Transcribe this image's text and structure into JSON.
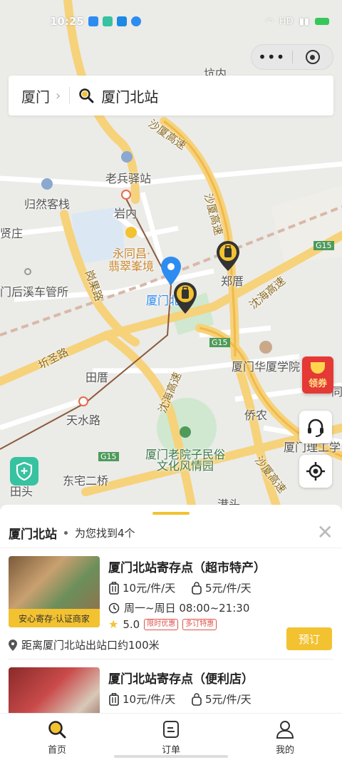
{
  "status_bar": {
    "time": "10:25",
    "network": "HD"
  },
  "colors": {
    "accent": "#f2c230",
    "pin_blue": "#2d8cf0",
    "tag_red": "#e0534c",
    "green": "#37c2a0",
    "coupon_red": "#e53935"
  },
  "search": {
    "city": "厦门",
    "query": "厦门北站"
  },
  "map": {
    "labels": {
      "kengnei": "坑内",
      "shaxia_top": "沙厦高速",
      "shaxia_mid": "沙厦高速",
      "laobing": "老兵驿站",
      "guiran": "归然客栈",
      "yannei": "岩内",
      "xianzhuang": "贤庄",
      "yongtongchang_1": "永同昌·",
      "yongtongchang_2": "翡翠峯境",
      "zhengcuo": "郑厝",
      "menhou": "门后溪车管所",
      "xiamen_north": "厦门北",
      "gonguo": "岗果路",
      "shenhai": "沈海高速",
      "g15_a": "G15",
      "g15_b": "G15",
      "g15_c": "G15",
      "huaxia": "厦门华厦学院",
      "hongsheng": "圻圣路",
      "tiancuo": "田厝",
      "shenhai_2": "沈海高速",
      "tianshui": "天水路",
      "qiaonong": "侨农",
      "laoyuanzi_1": "厦门老院子民俗",
      "laoyuanzi_2": "文化风情园",
      "ligong": "厦门理工学",
      "shaxia_bottom": "沙厦高速",
      "dongzhai": "东宅二桥",
      "tiantou": "田头",
      "gangtou": "港头",
      "right_edge": "同"
    }
  },
  "coupon": {
    "label": "领券"
  },
  "sheet": {
    "title": "厦门北站",
    "count_text": "为您找到4个"
  },
  "results": [
    {
      "name": "厦门北站寄存点（超市特产）",
      "price_large": "10元/件/天",
      "price_small": "5元/件/天",
      "hours": "周一~周日 08:00~21:30",
      "rating": "5.0",
      "tags": [
        "限时优惠",
        "多订特惠"
      ],
      "badge": "安心寄存·认证商家",
      "distance": "距离厦门北站出站口约100米",
      "book_label": "预订"
    },
    {
      "name": "厦门北站寄存点（便利店）",
      "price_large": "10元/件/天",
      "price_small": "5元/件/天"
    }
  ],
  "tabs": [
    {
      "label": "首页",
      "icon": "search-icon",
      "active": true
    },
    {
      "label": "订单",
      "icon": "order-icon",
      "active": false
    },
    {
      "label": "我的",
      "icon": "profile-icon",
      "active": false
    }
  ]
}
